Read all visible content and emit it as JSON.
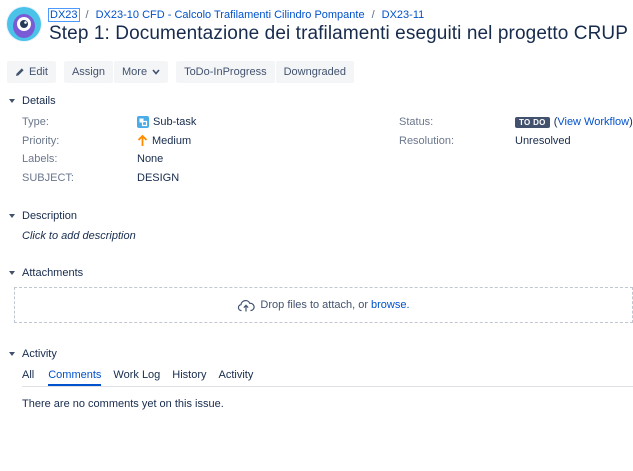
{
  "colors": {
    "accent": "#0052cc",
    "lozenge": "#42526e",
    "button_bg": "#f4f5f7",
    "priority": "#ff8b00",
    "subtask": "#4bade8"
  },
  "breadcrumb": {
    "project": "DX23",
    "parent": "DX23-10 CFD - Calcolo Trafilamenti Cilindro Pompante",
    "issue": "DX23-11",
    "separator": "/"
  },
  "title": "Step 1: Documentazione dei trafilamenti eseguiti nel progetto CRUP",
  "toolbar": {
    "edit": "Edit",
    "assign": "Assign",
    "more": "More",
    "todo_inprogress": "ToDo-InProgress",
    "downgraded": "Downgraded"
  },
  "details": {
    "heading": "Details",
    "type_label": "Type:",
    "type_value": "Sub-task",
    "type_icon": "subtask-icon",
    "priority_label": "Priority:",
    "priority_value": "Medium",
    "priority_icon": "arrow-up-icon",
    "labels_label": "Labels:",
    "labels_value": "None",
    "subject_label": "SUBJECT:",
    "subject_value": "DESIGN",
    "status_label": "Status:",
    "status_value": "TO DO",
    "view_workflow": "View Workflow",
    "resolution_label": "Resolution:",
    "resolution_value": "Unresolved"
  },
  "description": {
    "heading": "Description",
    "placeholder": "Click to add description"
  },
  "attachments": {
    "heading": "Attachments",
    "drop_text": "Drop files to attach, or",
    "browse": "browse."
  },
  "activity": {
    "heading": "Activity",
    "tabs": [
      "All",
      "Comments",
      "Work Log",
      "History",
      "Activity"
    ],
    "active_tab": "Comments",
    "empty_message": "There are no comments yet on this issue."
  }
}
